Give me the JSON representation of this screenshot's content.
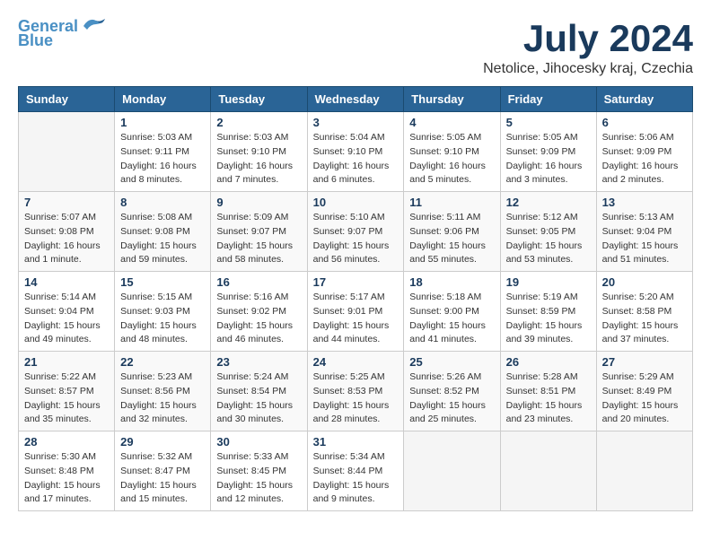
{
  "header": {
    "logo_line1": "General",
    "logo_line2": "Blue",
    "month_title": "July 2024",
    "location": "Netolice, Jihocesky kraj, Czechia"
  },
  "weekdays": [
    "Sunday",
    "Monday",
    "Tuesday",
    "Wednesday",
    "Thursday",
    "Friday",
    "Saturday"
  ],
  "weeks": [
    [
      {
        "day": "",
        "info": ""
      },
      {
        "day": "1",
        "info": "Sunrise: 5:03 AM\nSunset: 9:11 PM\nDaylight: 16 hours\nand 8 minutes."
      },
      {
        "day": "2",
        "info": "Sunrise: 5:03 AM\nSunset: 9:10 PM\nDaylight: 16 hours\nand 7 minutes."
      },
      {
        "day": "3",
        "info": "Sunrise: 5:04 AM\nSunset: 9:10 PM\nDaylight: 16 hours\nand 6 minutes."
      },
      {
        "day": "4",
        "info": "Sunrise: 5:05 AM\nSunset: 9:10 PM\nDaylight: 16 hours\nand 5 minutes."
      },
      {
        "day": "5",
        "info": "Sunrise: 5:05 AM\nSunset: 9:09 PM\nDaylight: 16 hours\nand 3 minutes."
      },
      {
        "day": "6",
        "info": "Sunrise: 5:06 AM\nSunset: 9:09 PM\nDaylight: 16 hours\nand 2 minutes."
      }
    ],
    [
      {
        "day": "7",
        "info": "Sunrise: 5:07 AM\nSunset: 9:08 PM\nDaylight: 16 hours\nand 1 minute."
      },
      {
        "day": "8",
        "info": "Sunrise: 5:08 AM\nSunset: 9:08 PM\nDaylight: 15 hours\nand 59 minutes."
      },
      {
        "day": "9",
        "info": "Sunrise: 5:09 AM\nSunset: 9:07 PM\nDaylight: 15 hours\nand 58 minutes."
      },
      {
        "day": "10",
        "info": "Sunrise: 5:10 AM\nSunset: 9:07 PM\nDaylight: 15 hours\nand 56 minutes."
      },
      {
        "day": "11",
        "info": "Sunrise: 5:11 AM\nSunset: 9:06 PM\nDaylight: 15 hours\nand 55 minutes."
      },
      {
        "day": "12",
        "info": "Sunrise: 5:12 AM\nSunset: 9:05 PM\nDaylight: 15 hours\nand 53 minutes."
      },
      {
        "day": "13",
        "info": "Sunrise: 5:13 AM\nSunset: 9:04 PM\nDaylight: 15 hours\nand 51 minutes."
      }
    ],
    [
      {
        "day": "14",
        "info": "Sunrise: 5:14 AM\nSunset: 9:04 PM\nDaylight: 15 hours\nand 49 minutes."
      },
      {
        "day": "15",
        "info": "Sunrise: 5:15 AM\nSunset: 9:03 PM\nDaylight: 15 hours\nand 48 minutes."
      },
      {
        "day": "16",
        "info": "Sunrise: 5:16 AM\nSunset: 9:02 PM\nDaylight: 15 hours\nand 46 minutes."
      },
      {
        "day": "17",
        "info": "Sunrise: 5:17 AM\nSunset: 9:01 PM\nDaylight: 15 hours\nand 44 minutes."
      },
      {
        "day": "18",
        "info": "Sunrise: 5:18 AM\nSunset: 9:00 PM\nDaylight: 15 hours\nand 41 minutes."
      },
      {
        "day": "19",
        "info": "Sunrise: 5:19 AM\nSunset: 8:59 PM\nDaylight: 15 hours\nand 39 minutes."
      },
      {
        "day": "20",
        "info": "Sunrise: 5:20 AM\nSunset: 8:58 PM\nDaylight: 15 hours\nand 37 minutes."
      }
    ],
    [
      {
        "day": "21",
        "info": "Sunrise: 5:22 AM\nSunset: 8:57 PM\nDaylight: 15 hours\nand 35 minutes."
      },
      {
        "day": "22",
        "info": "Sunrise: 5:23 AM\nSunset: 8:56 PM\nDaylight: 15 hours\nand 32 minutes."
      },
      {
        "day": "23",
        "info": "Sunrise: 5:24 AM\nSunset: 8:54 PM\nDaylight: 15 hours\nand 30 minutes."
      },
      {
        "day": "24",
        "info": "Sunrise: 5:25 AM\nSunset: 8:53 PM\nDaylight: 15 hours\nand 28 minutes."
      },
      {
        "day": "25",
        "info": "Sunrise: 5:26 AM\nSunset: 8:52 PM\nDaylight: 15 hours\nand 25 minutes."
      },
      {
        "day": "26",
        "info": "Sunrise: 5:28 AM\nSunset: 8:51 PM\nDaylight: 15 hours\nand 23 minutes."
      },
      {
        "day": "27",
        "info": "Sunrise: 5:29 AM\nSunset: 8:49 PM\nDaylight: 15 hours\nand 20 minutes."
      }
    ],
    [
      {
        "day": "28",
        "info": "Sunrise: 5:30 AM\nSunset: 8:48 PM\nDaylight: 15 hours\nand 17 minutes."
      },
      {
        "day": "29",
        "info": "Sunrise: 5:32 AM\nSunset: 8:47 PM\nDaylight: 15 hours\nand 15 minutes."
      },
      {
        "day": "30",
        "info": "Sunrise: 5:33 AM\nSunset: 8:45 PM\nDaylight: 15 hours\nand 12 minutes."
      },
      {
        "day": "31",
        "info": "Sunrise: 5:34 AM\nSunset: 8:44 PM\nDaylight: 15 hours\nand 9 minutes."
      },
      {
        "day": "",
        "info": ""
      },
      {
        "day": "",
        "info": ""
      },
      {
        "day": "",
        "info": ""
      }
    ]
  ]
}
